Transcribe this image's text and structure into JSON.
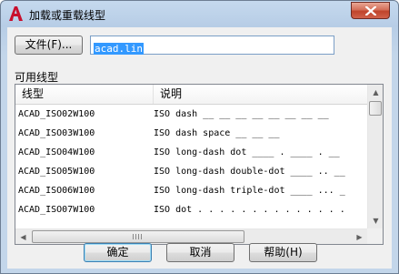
{
  "window": {
    "title": "加载或重载线型"
  },
  "file": {
    "button_label": "文件(F)...",
    "value": "acad.lin"
  },
  "list": {
    "group_label": "可用线型",
    "columns": [
      "线型",
      "说明"
    ],
    "rows": [
      {
        "name": "ACAD_ISO02W100",
        "desc": "ISO dash __ __ __ __ __ __ __ __"
      },
      {
        "name": "ACAD_ISO03W100",
        "desc": "ISO dash space __    __    __"
      },
      {
        "name": "ACAD_ISO04W100",
        "desc": "ISO long-dash dot ____ . ____ . __"
      },
      {
        "name": "ACAD_ISO05W100",
        "desc": "ISO long-dash double-dot ____ .. __"
      },
      {
        "name": "ACAD_ISO06W100",
        "desc": "ISO long-dash triple-dot ____ ... _"
      },
      {
        "name": "ACAD_ISO07W100",
        "desc": "ISO dot . . . . . . . . . . . . . ."
      }
    ]
  },
  "buttons": {
    "ok": "确定",
    "cancel": "取消",
    "help": "帮助(H)"
  }
}
